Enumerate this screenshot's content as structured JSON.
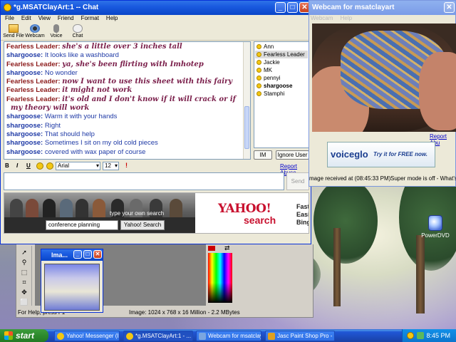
{
  "chat": {
    "title": "*g.MSATClayArt:1 -- Chat",
    "menu": [
      "File",
      "Edit",
      "View",
      "Friend",
      "Format",
      "Help"
    ],
    "tools": [
      "Send File",
      "Webcam",
      "Voice",
      "Chat"
    ],
    "messages": [
      {
        "who": "Fearless Leader:",
        "text": "she's a little over 3 inches tall",
        "kind": "fl"
      },
      {
        "who": "shargoose:",
        "text": "It looks like a washboard",
        "kind": "sg"
      },
      {
        "who": "Fearless Leader:",
        "text": "ya, she's been flirting with Imhotep",
        "kind": "fl"
      },
      {
        "who": "shargoose:",
        "text": "No wonder",
        "kind": "sg"
      },
      {
        "who": "Fearless Leader:",
        "text": "now I want to use this sheet with this fairy",
        "kind": "fl"
      },
      {
        "who": "Fearless Leader:",
        "text": "it might not work",
        "kind": "fl"
      },
      {
        "who": "Fearless Leader:",
        "text": "it's old and I don't know if it will crack or if",
        "kind": "fl"
      },
      {
        "who": "",
        "text": "my theory will work",
        "kind": "fl"
      },
      {
        "who": "shargoose:",
        "text": "Warm it with your hands",
        "kind": "sg"
      },
      {
        "who": "shargoose:",
        "text": "Right",
        "kind": "sg"
      },
      {
        "who": "shargoose:",
        "text": "That should help",
        "kind": "sg"
      },
      {
        "who": "shargoose:",
        "text": "Sometimes I sit on my old cold pieces",
        "kind": "sg"
      },
      {
        "who": "shargoose:",
        "text": "covered with wax paper of course",
        "kind": "sg"
      }
    ],
    "users": [
      "Ann",
      "Fearless Leader",
      "Jackie",
      "MK",
      "pennyi",
      "shargoose",
      "Stamphi"
    ],
    "selected_user": "Fearless Leader",
    "bold_user": "shargoose",
    "im_button": "IM",
    "ignore_button": "Ignore User",
    "format": {
      "bold": "B",
      "italic": "I",
      "underline": "U",
      "font": "Arial",
      "size": "12"
    },
    "report_abuse": "Report Abuse",
    "send": "Send",
    "ad": {
      "tagline": "type your own search",
      "query": "conference planning",
      "button": "Yahoo! Search",
      "logo": "YAHOO!",
      "logo_sub": "search",
      "side": [
        "Faste",
        "Easie",
        "Binge"
      ]
    }
  },
  "webcam": {
    "title": "Webcam for msatclayart",
    "menu": [
      "Webcam",
      "Help"
    ],
    "report_abuse": "Report Abu",
    "ad_logo": "voiceglo",
    "ad_text": "Try it for FREE now.",
    "status_received": "mage received at (08:45:33 PM)",
    "status_super": "Super mode is off - What's thi"
  },
  "psp": {
    "mini_title": "Ima...",
    "status_help": "For Help, press F1",
    "status_image": "Image:  1024 x 768 x 16 Million - 2.2 MBytes",
    "palette_arrows": "⇄"
  },
  "desktop": {
    "icon_label": "PowerDVD"
  },
  "taskbar": {
    "start": "start",
    "buttons": [
      "Yahoo! Messenger (I...",
      "*g.MSATClayArt:1 - ...",
      "Webcam for msatclay...",
      "Jasc Paint Shop Pro - ..."
    ],
    "clock": "8:45 PM"
  }
}
